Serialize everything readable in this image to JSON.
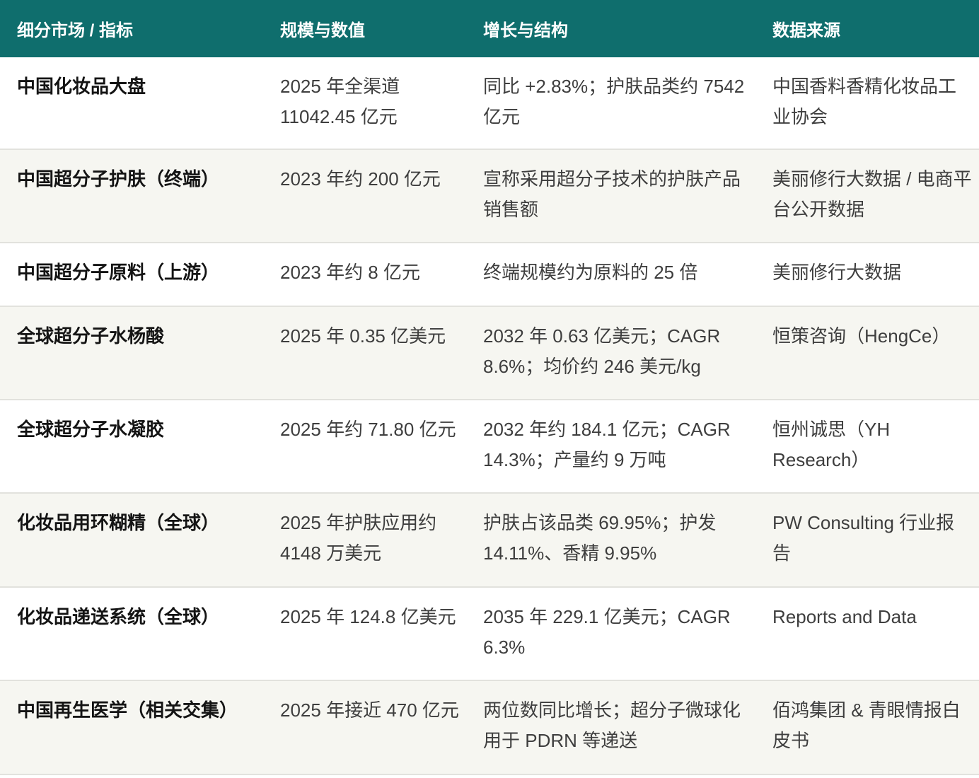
{
  "header": [
    "细分市场 / 指标",
    "规模与数值",
    "增长与结构",
    "数据来源"
  ],
  "rows": [
    {
      "market": "中国化妆品大盘",
      "size": "2025 年全渠道 11042.45 亿元",
      "growth": "同比 +2.83%；护肤品类约 7542 亿元",
      "source": "中国香料香精化妆品工业协会"
    },
    {
      "market": "中国超分子护肤（终端）",
      "size": "2023 年约 200 亿元",
      "growth": "宣称采用超分子技术的护肤产品销售额",
      "source": "美丽修行大数据 / 电商平台公开数据"
    },
    {
      "market": "中国超分子原料（上游）",
      "size": "2023 年约 8 亿元",
      "growth": "终端规模约为原料的 25 倍",
      "source": "美丽修行大数据"
    },
    {
      "market": "全球超分子水杨酸",
      "size": "2025 年 0.35 亿美元",
      "growth": "2032 年 0.63 亿美元；CAGR 8.6%；均价约 246 美元/kg",
      "source": "恒策咨询（HengCe）"
    },
    {
      "market": "全球超分子水凝胶",
      "size": "2025 年约 71.80 亿元",
      "growth": "2032 年约 184.1 亿元；CAGR 14.3%；产量约 9 万吨",
      "source": "恒州诚思（YH Research）"
    },
    {
      "market": "化妆品用环糊精（全球）",
      "size": "2025 年护肤应用约 4148 万美元",
      "growth": "护肤占该品类 69.95%；护发 14.11%、香精 9.95%",
      "source": "PW Consulting 行业报告"
    },
    {
      "market": "化妆品递送系统（全球）",
      "size": "2025 年 124.8 亿美元",
      "growth": "2035 年 229.1 亿美元；CAGR 6.3%",
      "source": "Reports and Data"
    },
    {
      "market": "中国再生医学（相关交集）",
      "size": "2025 年接近 470 亿元",
      "growth": "两位数同比增长；超分子微球化用于 PDRN 等递送",
      "source": "佰鸿集团 & 青眼情报白皮书"
    }
  ]
}
